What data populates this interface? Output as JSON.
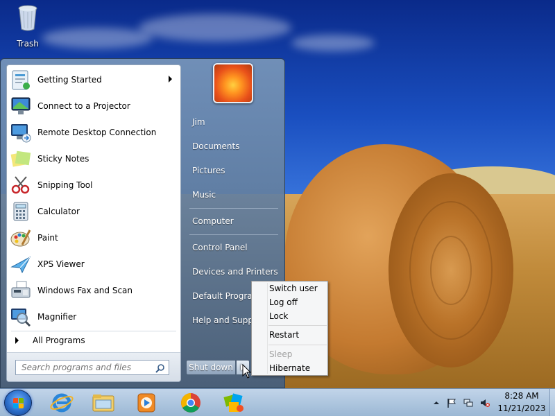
{
  "desktop": {
    "icons": [
      {
        "label": "Trash",
        "icon": "trash-icon"
      }
    ]
  },
  "start_menu": {
    "programs": [
      {
        "label": "Getting Started",
        "icon": "getting-started-icon",
        "has_submenu": true
      },
      {
        "label": "Connect to a Projector",
        "icon": "projector-icon"
      },
      {
        "label": "Remote Desktop Connection",
        "icon": "remote-desktop-icon"
      },
      {
        "label": "Sticky Notes",
        "icon": "sticky-notes-icon"
      },
      {
        "label": "Snipping Tool",
        "icon": "snipping-tool-icon"
      },
      {
        "label": "Calculator",
        "icon": "calculator-icon"
      },
      {
        "label": "Paint",
        "icon": "paint-icon"
      },
      {
        "label": "XPS Viewer",
        "icon": "xps-viewer-icon"
      },
      {
        "label": "Windows Fax and Scan",
        "icon": "fax-scan-icon"
      },
      {
        "label": "Magnifier",
        "icon": "magnifier-icon"
      }
    ],
    "all_programs_label": "All Programs",
    "search_placeholder": "Search programs and files",
    "right_items": [
      {
        "label": "Jim"
      },
      {
        "label": "Documents"
      },
      {
        "label": "Pictures"
      },
      {
        "label": "Music"
      },
      {
        "label": "Computer"
      },
      {
        "label": "Control Panel"
      },
      {
        "label": "Devices and Printers"
      },
      {
        "label": "Default Programs"
      },
      {
        "label": "Help and Support"
      }
    ],
    "shutdown_label": "Shut down",
    "power_menu": [
      {
        "label": "Switch user",
        "enabled": true
      },
      {
        "label": "Log off",
        "enabled": true
      },
      {
        "label": "Lock",
        "enabled": true
      },
      {
        "label": "Restart",
        "enabled": true
      },
      {
        "label": "Sleep",
        "enabled": false
      },
      {
        "label": "Hibernate",
        "enabled": true
      }
    ]
  },
  "taskbar": {
    "pinned": [
      {
        "icon": "internet-explorer-icon"
      },
      {
        "icon": "file-explorer-icon"
      },
      {
        "icon": "media-player-icon"
      },
      {
        "icon": "chrome-icon"
      },
      {
        "icon": "application-icon"
      }
    ],
    "clock": {
      "time": "8:28 AM",
      "date": "11/21/2023"
    }
  },
  "colors": {
    "accent": "#1f5fbf",
    "menu_panel": "#5c7694",
    "disabled_text": "#a0a0a0"
  }
}
